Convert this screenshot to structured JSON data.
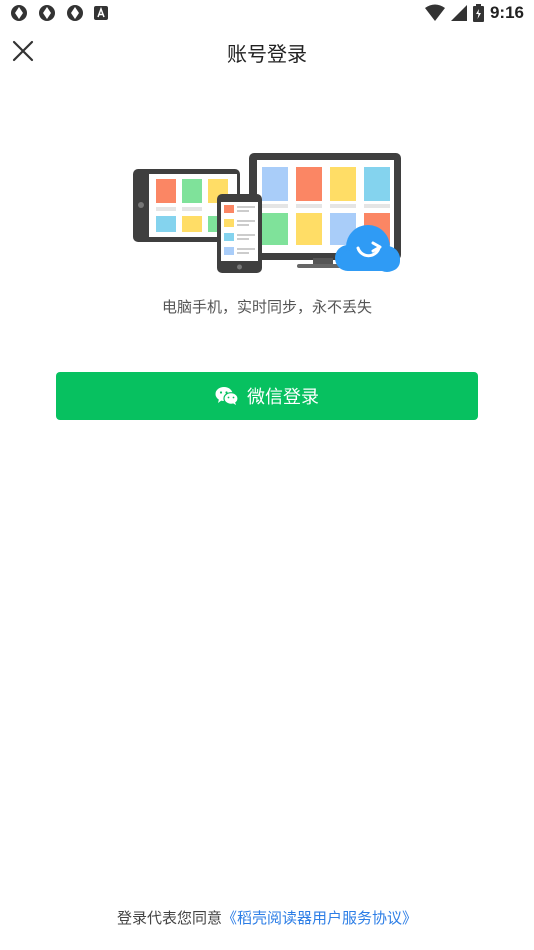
{
  "status_bar": {
    "time": "9:16",
    "left_icons": [
      "app-notification-icon",
      "app-notification-icon",
      "app-notification-icon",
      "keyboard-a-icon"
    ],
    "right_icons": [
      "wifi-icon",
      "cell-signal-icon",
      "battery-icon"
    ]
  },
  "header": {
    "title": "账号登录",
    "close_icon": "close-icon"
  },
  "hero": {
    "tagline": "电脑手机，实时同步，永不丢失"
  },
  "login": {
    "wechat_label": "微信登录",
    "wechat_icon": "wechat-icon",
    "button_color": "#07c160"
  },
  "agreement": {
    "prefix": "登录代表您同意",
    "link_text": "《稻壳阅读器用户服务协议》",
    "link_color": "#2d7ee6"
  }
}
